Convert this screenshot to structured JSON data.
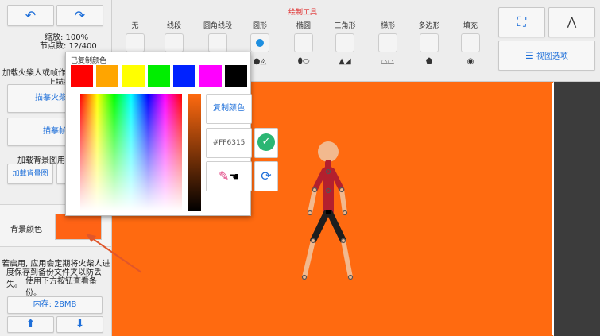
{
  "left_panel": {
    "undo_icon": "undo-icon",
    "redo_icon": "redo-icon",
    "zoom_text": "缩放: 100%",
    "points_text": "节点数: 12/400",
    "load_text": "加载火柴人或帧作为",
    "upper_text": "上描摹",
    "trace_stick_button": "描摹火柴人",
    "trace_frame_button": "描摹帧",
    "bg_load_text": "加载背景图用于",
    "load_bg_button": "加载背景图",
    "bg_color_label": "背景颜色",
    "bg_color": "#ff6315",
    "backup_notice_1": "若启用, 应用会定期将火柴人进",
    "backup_notice_2": "度保存到备份文件夹以防丢失。",
    "backup_notice_3": "使用下方按钮查看备份。",
    "memory_label": "内存: 28MB"
  },
  "toolbar": {
    "title": "绘制工具",
    "tools": [
      {
        "label": "无",
        "icon": "none-icon"
      },
      {
        "label": "线段",
        "icon": "line-icon"
      },
      {
        "label": "圆角线段",
        "icon": "rounded-line-icon"
      },
      {
        "label": "圆形",
        "icon": "circle-icon"
      },
      {
        "label": "椭圆",
        "icon": "ellipse-icon"
      },
      {
        "label": "三角形",
        "icon": "triangle-icon"
      },
      {
        "label": "梯形",
        "icon": "trapezoid-icon"
      },
      {
        "label": "多边形",
        "icon": "polygon-icon"
      },
      {
        "label": "填充",
        "icon": "fill-icon"
      }
    ],
    "view_options_label": "视图选项"
  },
  "color_picker": {
    "copied_label": "已复制颜色",
    "swatches": [
      "#ff0000",
      "#ffa500",
      "#ffff00",
      "#00ee00",
      "#0022ff",
      "#ff00ff",
      "#000000"
    ],
    "copy_color_button": "复制颜色",
    "hex_value": "#FF6315"
  },
  "colors": {
    "canvas": "#ff6a10",
    "accent": "#1e6fd9",
    "figure_top": "#b3202e",
    "figure_legs": "#1e1e1e",
    "figure_skin": "#f2b98e"
  }
}
